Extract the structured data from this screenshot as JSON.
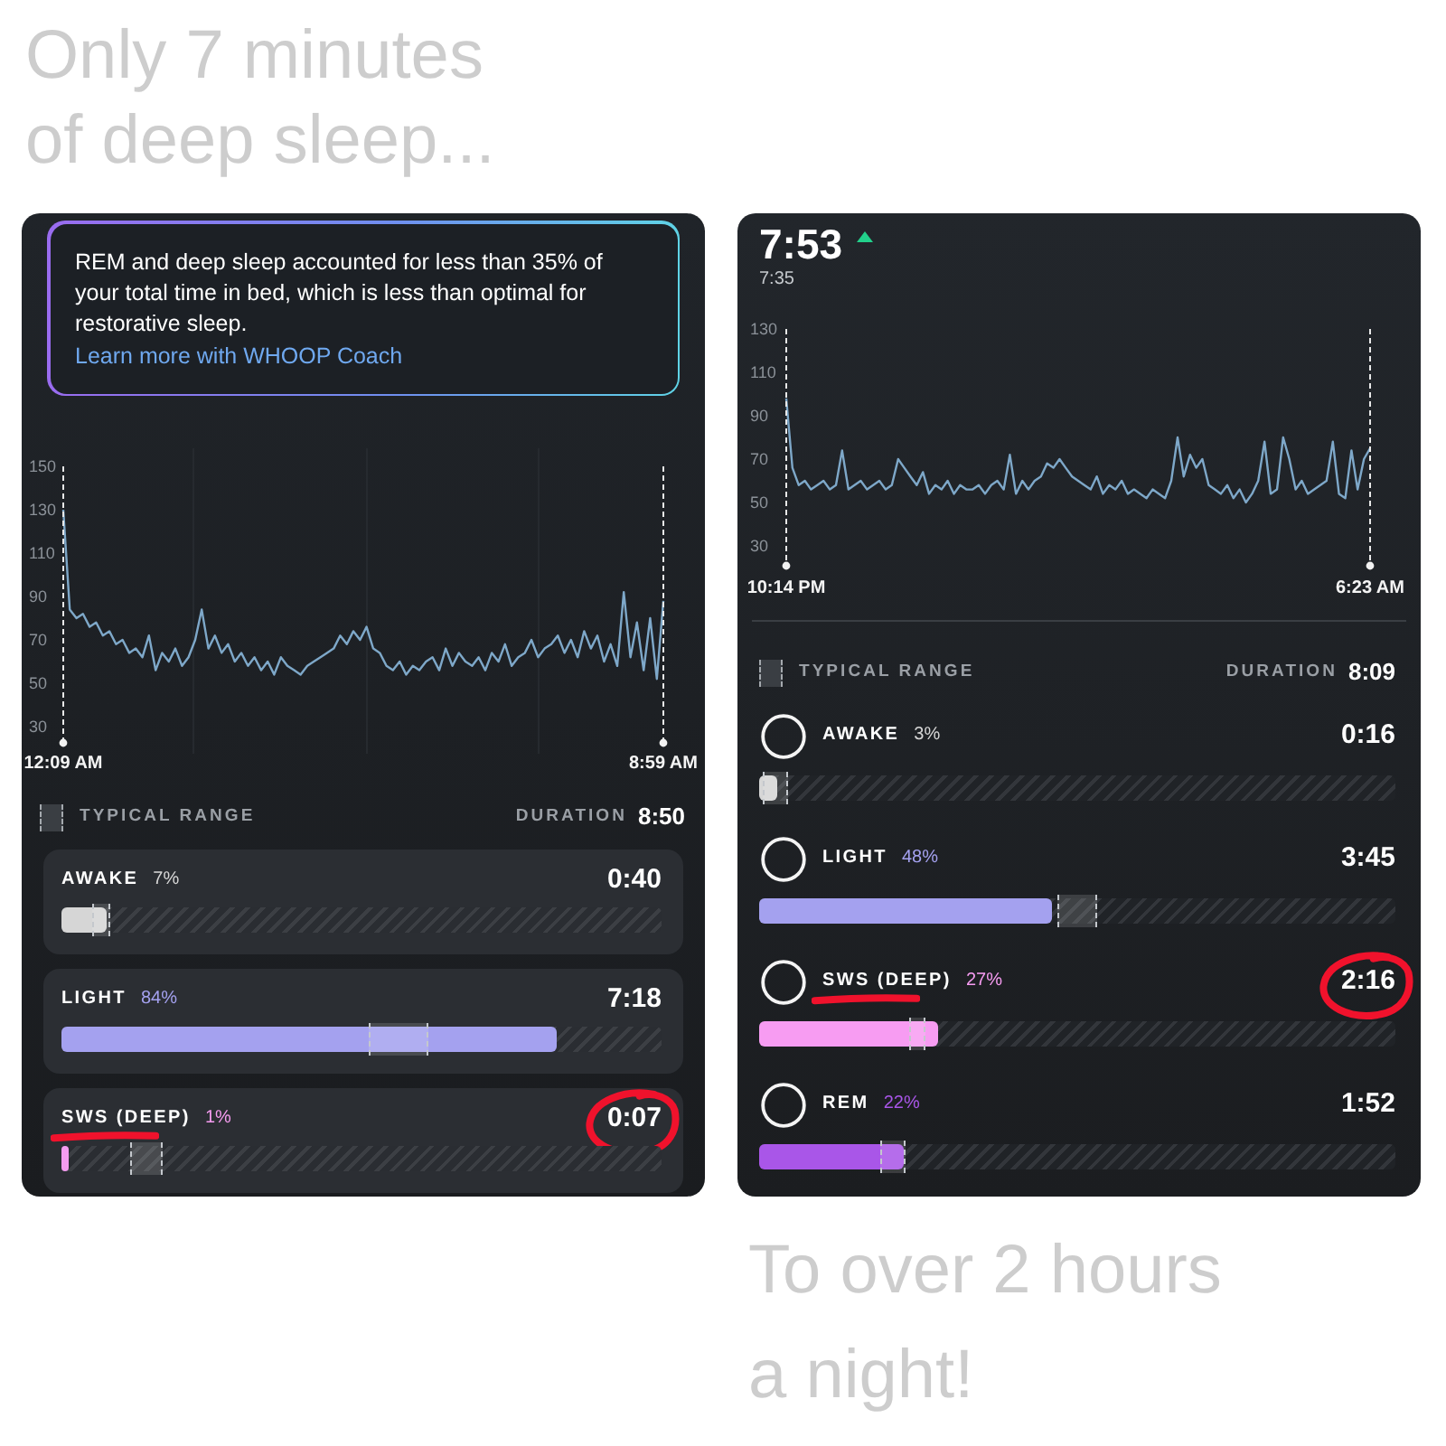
{
  "headline": "Only 7 minutes of deep sleep...",
  "panels": [
    {
      "kind": "cards",
      "insight": {
        "text": "REM and deep sleep accounted for less than 35% of your total time in bed, which is less than optimal for restorative sleep.",
        "link": "Learn more with WHOOP Coach"
      },
      "chart_data": {
        "type": "line",
        "ylim": [
          22.5,
          150
        ],
        "yticks": [
          30,
          50,
          70,
          90,
          110,
          130,
          150
        ],
        "categories": [
          "12:09 AM",
          null,
          null,
          null,
          null,
          null,
          null,
          null,
          null,
          null,
          null,
          null,
          null,
          null,
          null,
          null,
          null,
          null,
          null,
          null,
          null,
          null,
          null,
          null,
          null,
          null,
          null,
          null,
          null,
          null,
          null,
          null,
          null,
          null,
          null,
          null,
          null,
          null,
          null,
          null,
          null,
          null,
          null,
          null,
          null,
          null,
          null,
          null,
          null,
          null,
          null,
          null,
          null,
          null,
          null,
          null,
          null,
          null,
          null,
          null,
          null,
          null,
          null,
          null,
          null,
          null,
          null,
          null,
          null,
          null,
          null,
          null,
          null,
          null,
          null,
          null,
          null,
          null,
          null,
          null,
          null,
          null,
          null,
          null,
          null,
          null,
          null,
          null,
          null,
          null,
          null,
          "8:59 AM"
        ],
        "values": [
          130,
          84,
          80,
          82,
          76,
          78,
          72,
          74,
          68,
          70,
          64,
          66,
          62,
          72,
          56,
          64,
          60,
          66,
          58,
          62,
          70,
          84,
          66,
          72,
          64,
          68,
          60,
          64,
          58,
          62,
          56,
          60,
          54,
          62,
          58,
          56,
          54,
          58,
          60,
          62,
          64,
          66,
          72,
          68,
          74,
          70,
          76,
          66,
          64,
          58,
          56,
          60,
          54,
          58,
          56,
          60,
          62,
          56,
          66,
          58,
          64,
          60,
          58,
          62,
          56,
          64,
          60,
          68,
          58,
          62,
          64,
          70,
          62,
          66,
          68,
          72,
          64,
          70,
          62,
          74,
          66,
          72,
          60,
          68,
          58,
          92,
          62,
          78,
          56,
          80,
          52,
          88
        ]
      },
      "legend": {
        "label": "TYPICAL RANGE",
        "duration_label": "DURATION",
        "duration": "8:50"
      },
      "stages": [
        {
          "name": "AWAKE",
          "percent": "7%",
          "time": "0:40",
          "level": 0.075,
          "color": "#d6d6d6",
          "typical_range": {
            "start": {
              "level": 0.05
            },
            "end": {
              "level": 0.082
            }
          },
          "label_underlined": false,
          "time_circled": false
        },
        {
          "name": "LIGHT",
          "percent": "84%",
          "time": "7:18",
          "level": 0.826,
          "color": "#a4a1ef",
          "typical_range": {
            "start": {
              "level": 0.512
            },
            "end": {
              "level": 0.611
            }
          },
          "label_underlined": false,
          "time_circled": false
        },
        {
          "name": "SWS (DEEP)",
          "percent": "1%",
          "time": "0:07",
          "level": 0.012,
          "color": "#f59cf0",
          "typical_range": {
            "start": {
              "level": 0.114
            },
            "end": {
              "level": 0.168
            }
          },
          "label_underlined": true,
          "time_circled": true
        }
      ]
    },
    {
      "kind": "list",
      "summary": {
        "value": "7:53",
        "trend_up": true,
        "baseline": "7:35"
      },
      "chart_data": {
        "type": "line",
        "ylim": [
          20.8,
          130
        ],
        "yticks": [
          30,
          50,
          70,
          90,
          110,
          130
        ],
        "categories": [
          "10:14 PM",
          null,
          null,
          null,
          null,
          null,
          null,
          null,
          null,
          null,
          null,
          null,
          null,
          null,
          null,
          null,
          null,
          null,
          null,
          null,
          null,
          null,
          null,
          null,
          null,
          null,
          null,
          null,
          null,
          null,
          null,
          null,
          null,
          null,
          null,
          null,
          null,
          null,
          null,
          null,
          null,
          null,
          null,
          null,
          null,
          null,
          null,
          null,
          null,
          null,
          null,
          null,
          null,
          null,
          null,
          null,
          null,
          null,
          null,
          null,
          null,
          null,
          null,
          null,
          null,
          null,
          null,
          null,
          null,
          null,
          null,
          null,
          null,
          null,
          null,
          null,
          null,
          null,
          null,
          null,
          null,
          null,
          null,
          null,
          null,
          null,
          null,
          null,
          null,
          null,
          null,
          null,
          null,
          null,
          "6:23 AM"
        ],
        "values": [
          98,
          66,
          58,
          60,
          56,
          58,
          60,
          56,
          58,
          74,
          56,
          58,
          60,
          56,
          58,
          60,
          56,
          58,
          70,
          66,
          62,
          58,
          64,
          54,
          58,
          56,
          60,
          54,
          58,
          56,
          56,
          58,
          54,
          58,
          60,
          56,
          72,
          54,
          60,
          56,
          60,
          62,
          68,
          66,
          70,
          66,
          62,
          60,
          58,
          56,
          62,
          54,
          58,
          56,
          60,
          54,
          56,
          54,
          52,
          56,
          54,
          52,
          60,
          80,
          62,
          72,
          66,
          70,
          58,
          56,
          54,
          58,
          52,
          56,
          50,
          54,
          60,
          78,
          54,
          56,
          80,
          70,
          56,
          60,
          54,
          56,
          58,
          60,
          78,
          54,
          52,
          74,
          56,
          70,
          75
        ]
      },
      "legend": {
        "label": "TYPICAL RANGE",
        "duration_label": "DURATION",
        "duration": "8:09"
      },
      "stages": [
        {
          "name": "AWAKE",
          "percent": "3%",
          "time": "0:16",
          "level": 0.028,
          "color": "#d6d6d6",
          "typical_range": {
            "start": {
              "level": 0.006
            },
            "end": {
              "level": 0.045
            }
          },
          "label_underlined": false,
          "time_circled": false
        },
        {
          "name": "LIGHT",
          "percent": "48%",
          "time": "3:45",
          "level": 0.46,
          "color": "#a4a1ef",
          "typical_range": {
            "start": {
              "level": 0.47
            },
            "end": {
              "level": 0.53
            }
          },
          "label_underlined": false,
          "time_circled": false
        },
        {
          "name": "SWS (DEEP)",
          "percent": "27%",
          "time": "2:16",
          "level": 0.28,
          "color": "#f79cf2",
          "typical_range": {
            "start": {
              "level": 0.236
            },
            "end": {
              "level": 0.262
            }
          },
          "label_underlined": true,
          "time_circled": true
        },
        {
          "name": "REM",
          "percent": "22%",
          "time": "1:52",
          "level": 0.227,
          "color": "#a956e8",
          "typical_range": {
            "start": {
              "level": 0.19
            },
            "end": {
              "level": 0.23
            }
          },
          "label_underlined": false,
          "time_circled": false
        }
      ]
    }
  ],
  "footer_headline": "To over 2 hours a night!"
}
